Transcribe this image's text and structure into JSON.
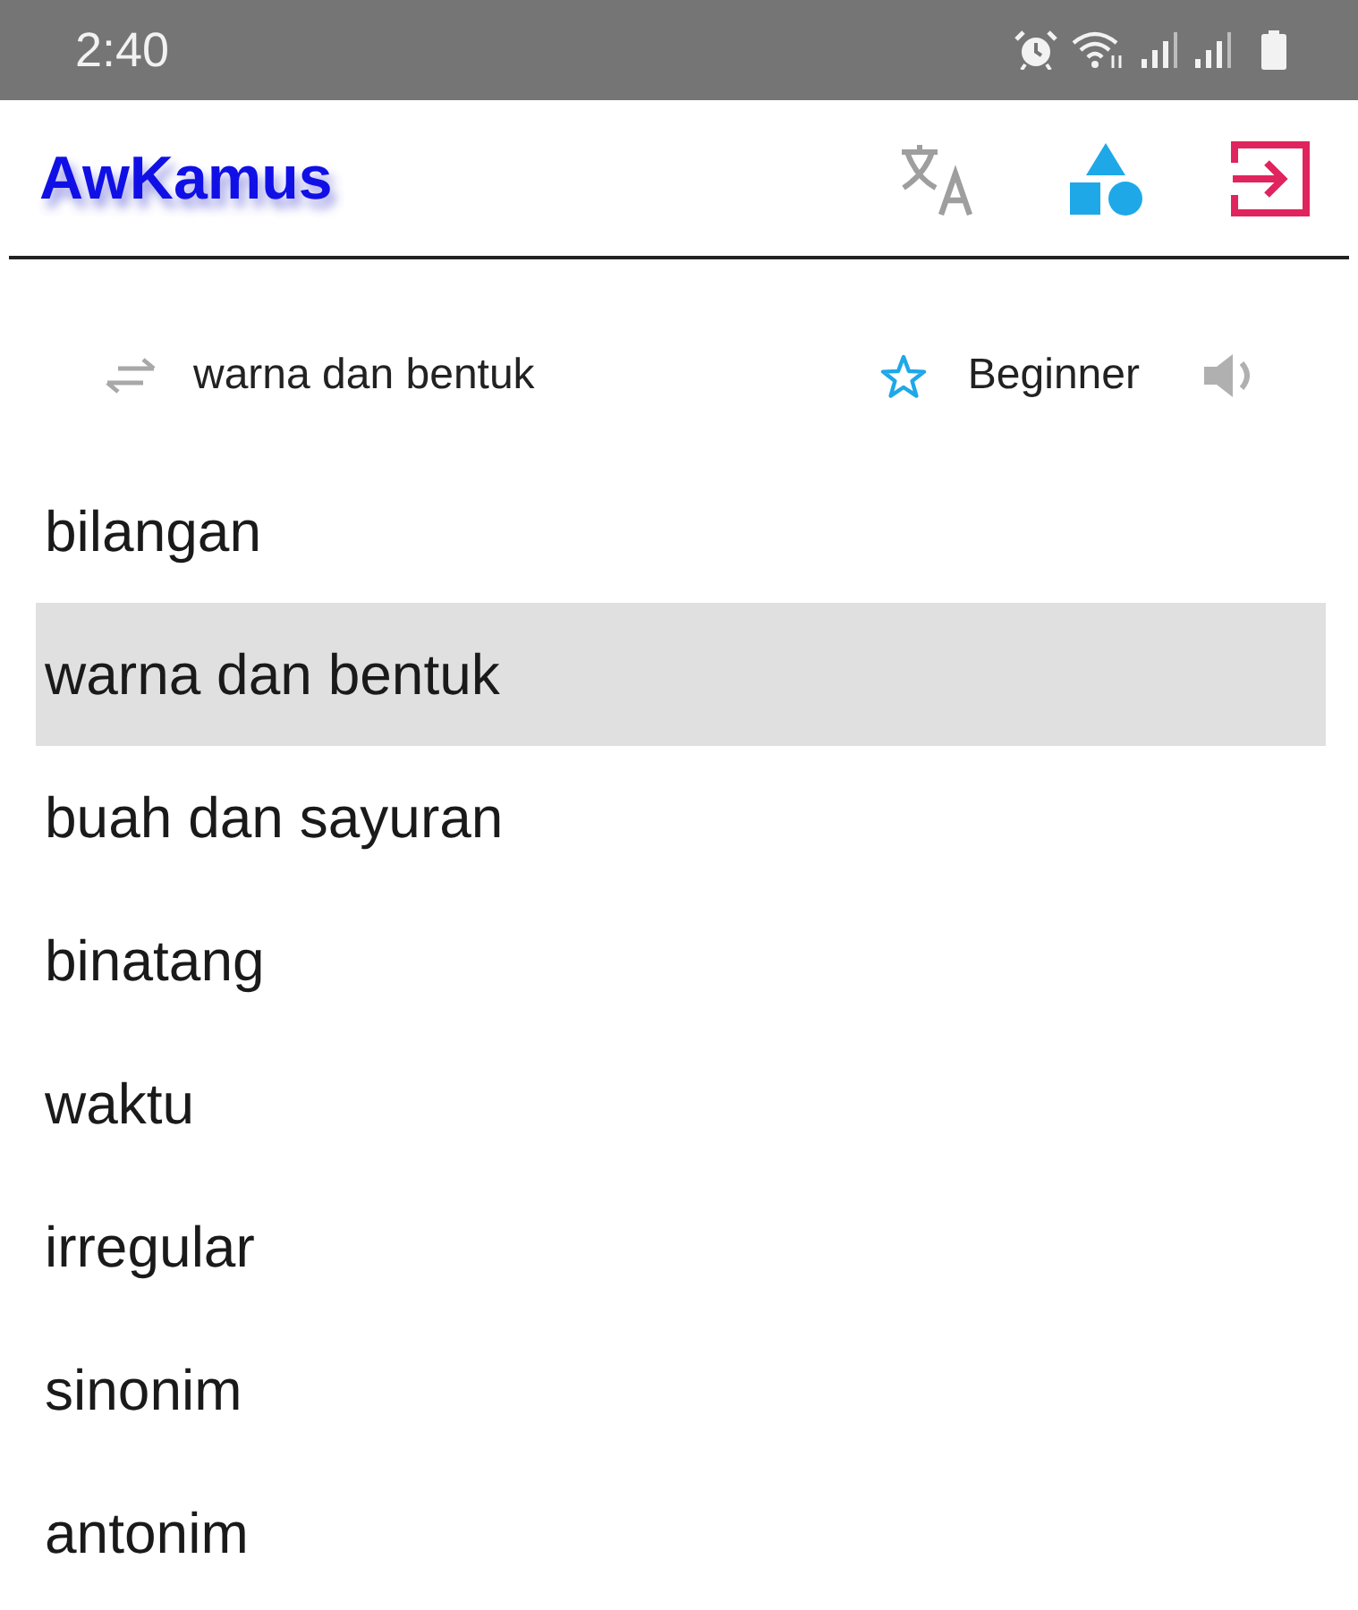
{
  "status_bar": {
    "time": "2:40"
  },
  "app_bar": {
    "title": "AwKamus"
  },
  "lesson_header": {
    "topic": "warna dan bentuk",
    "starred": false,
    "difficulty": "Beginner"
  },
  "categories": [
    {
      "label": "bilangan",
      "selected": false
    },
    {
      "label": "warna dan bentuk",
      "selected": true
    },
    {
      "label": "buah dan sayuran",
      "selected": false
    },
    {
      "label": "binatang",
      "selected": false
    },
    {
      "label": "waktu",
      "selected": false
    },
    {
      "label": "irregular",
      "selected": false
    },
    {
      "label": "sinonim",
      "selected": false
    },
    {
      "label": "antonim",
      "selected": false
    }
  ]
}
